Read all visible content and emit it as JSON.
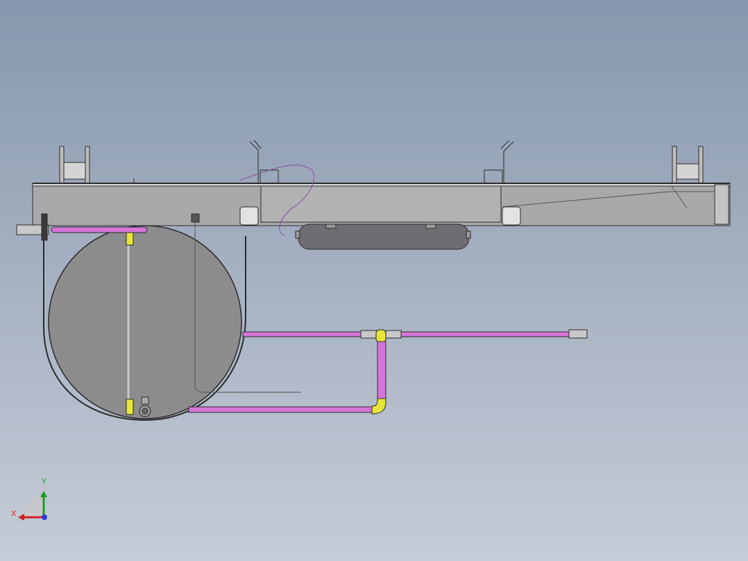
{
  "app": {
    "view": "cad-viewport",
    "projection": "front"
  },
  "colors": {
    "background_top": "#8797ad",
    "background_bottom": "#c5ccd7",
    "frame_fill": "#a9a9ab",
    "tank_fill": "#8c8c8c",
    "air_reservoir_fill": "#6f6d73",
    "brake_pipe": "#d575d8",
    "pipe_fitting": "#e7e43a",
    "outline": "#2a2a2a"
  },
  "triad": {
    "x_label": "X",
    "y_label": "Y",
    "x_color": "#d21f1f",
    "y_color": "#17a020",
    "z_color": "#2a3bd6"
  },
  "parts": [
    "main-frame-beam",
    "fuel-tank",
    "air-reservoir",
    "brake-pipe-assembly",
    "mounting-bracket"
  ]
}
